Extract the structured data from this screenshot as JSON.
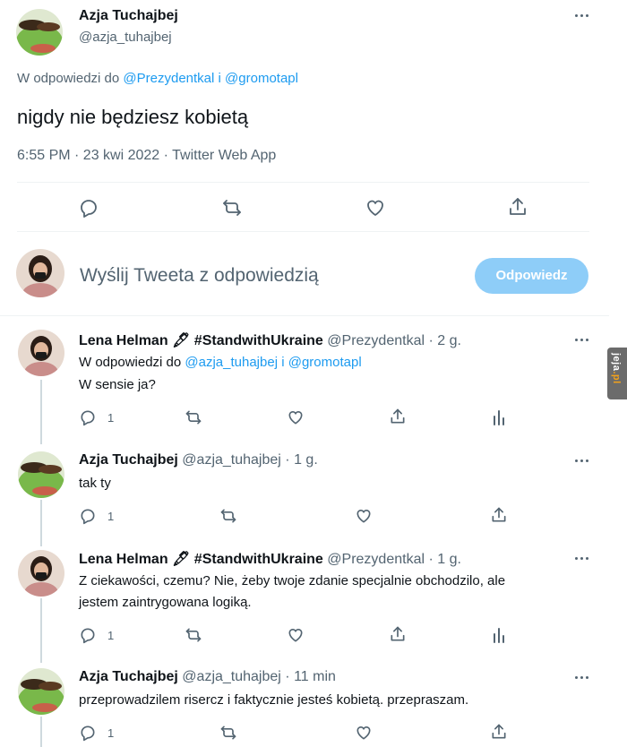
{
  "main_tweet": {
    "author_name": "Azja Tuchajbej",
    "author_handle": "@azja_tuhajbej",
    "reply_prefix": "W odpowiedzi do",
    "reply_user_1": "@Prezydentkal",
    "reply_joiner": "i",
    "reply_user_2": "@gromotapl",
    "text": "nigdy nie będziesz kobietą",
    "meta": "6:55 PM · 23 kwi 2022 · Twitter Web App"
  },
  "composer": {
    "placeholder": "Wyślij Tweeta z odpowiedzią",
    "button_label": "Odpowiedz"
  },
  "replies": [
    {
      "author_name": "Lena Helman 🖋 #StandwithUkraine",
      "author_handle": "@Prezydentkal",
      "time": "· 2 g.",
      "reply_prefix": "W odpowiedzi do",
      "reply_user_1": "@azja_tuhajbej",
      "reply_joiner": "i",
      "reply_user_2": "@gromotapl",
      "text_lines": [
        "W sensie ja?"
      ],
      "reply_count": "1"
    },
    {
      "author_name": "Azja Tuchajbej",
      "author_handle": "@azja_tuhajbej",
      "time": "· 1 g.",
      "text_lines": [
        "tak ty"
      ],
      "reply_count": "1"
    },
    {
      "author_name": "Lena Helman 🖋 #StandwithUkraine",
      "author_handle": "@Prezydentkal",
      "time": "· 1 g.",
      "text_lines": [
        "Z ciekawości, czemu? Nie, żeby twoje zdanie specjalnie obchodzilo, ale",
        "jestem zaintrygowana logiką."
      ],
      "reply_count": "1"
    },
    {
      "author_name": "Azja Tuchajbej",
      "author_handle": "@azja_tuhajbej",
      "time": "· 11 min",
      "text_lines": [
        "przeprowadzilem risercz i faktycznie jesteś kobietą. przepraszam."
      ],
      "reply_count": "1"
    }
  ],
  "watermark": {
    "text_main": "jeja",
    "text_accent": ".pl"
  },
  "colors": {
    "accent": "#1d9bf0",
    "button_disabled": "#8ecdf8",
    "muted": "#536471"
  }
}
